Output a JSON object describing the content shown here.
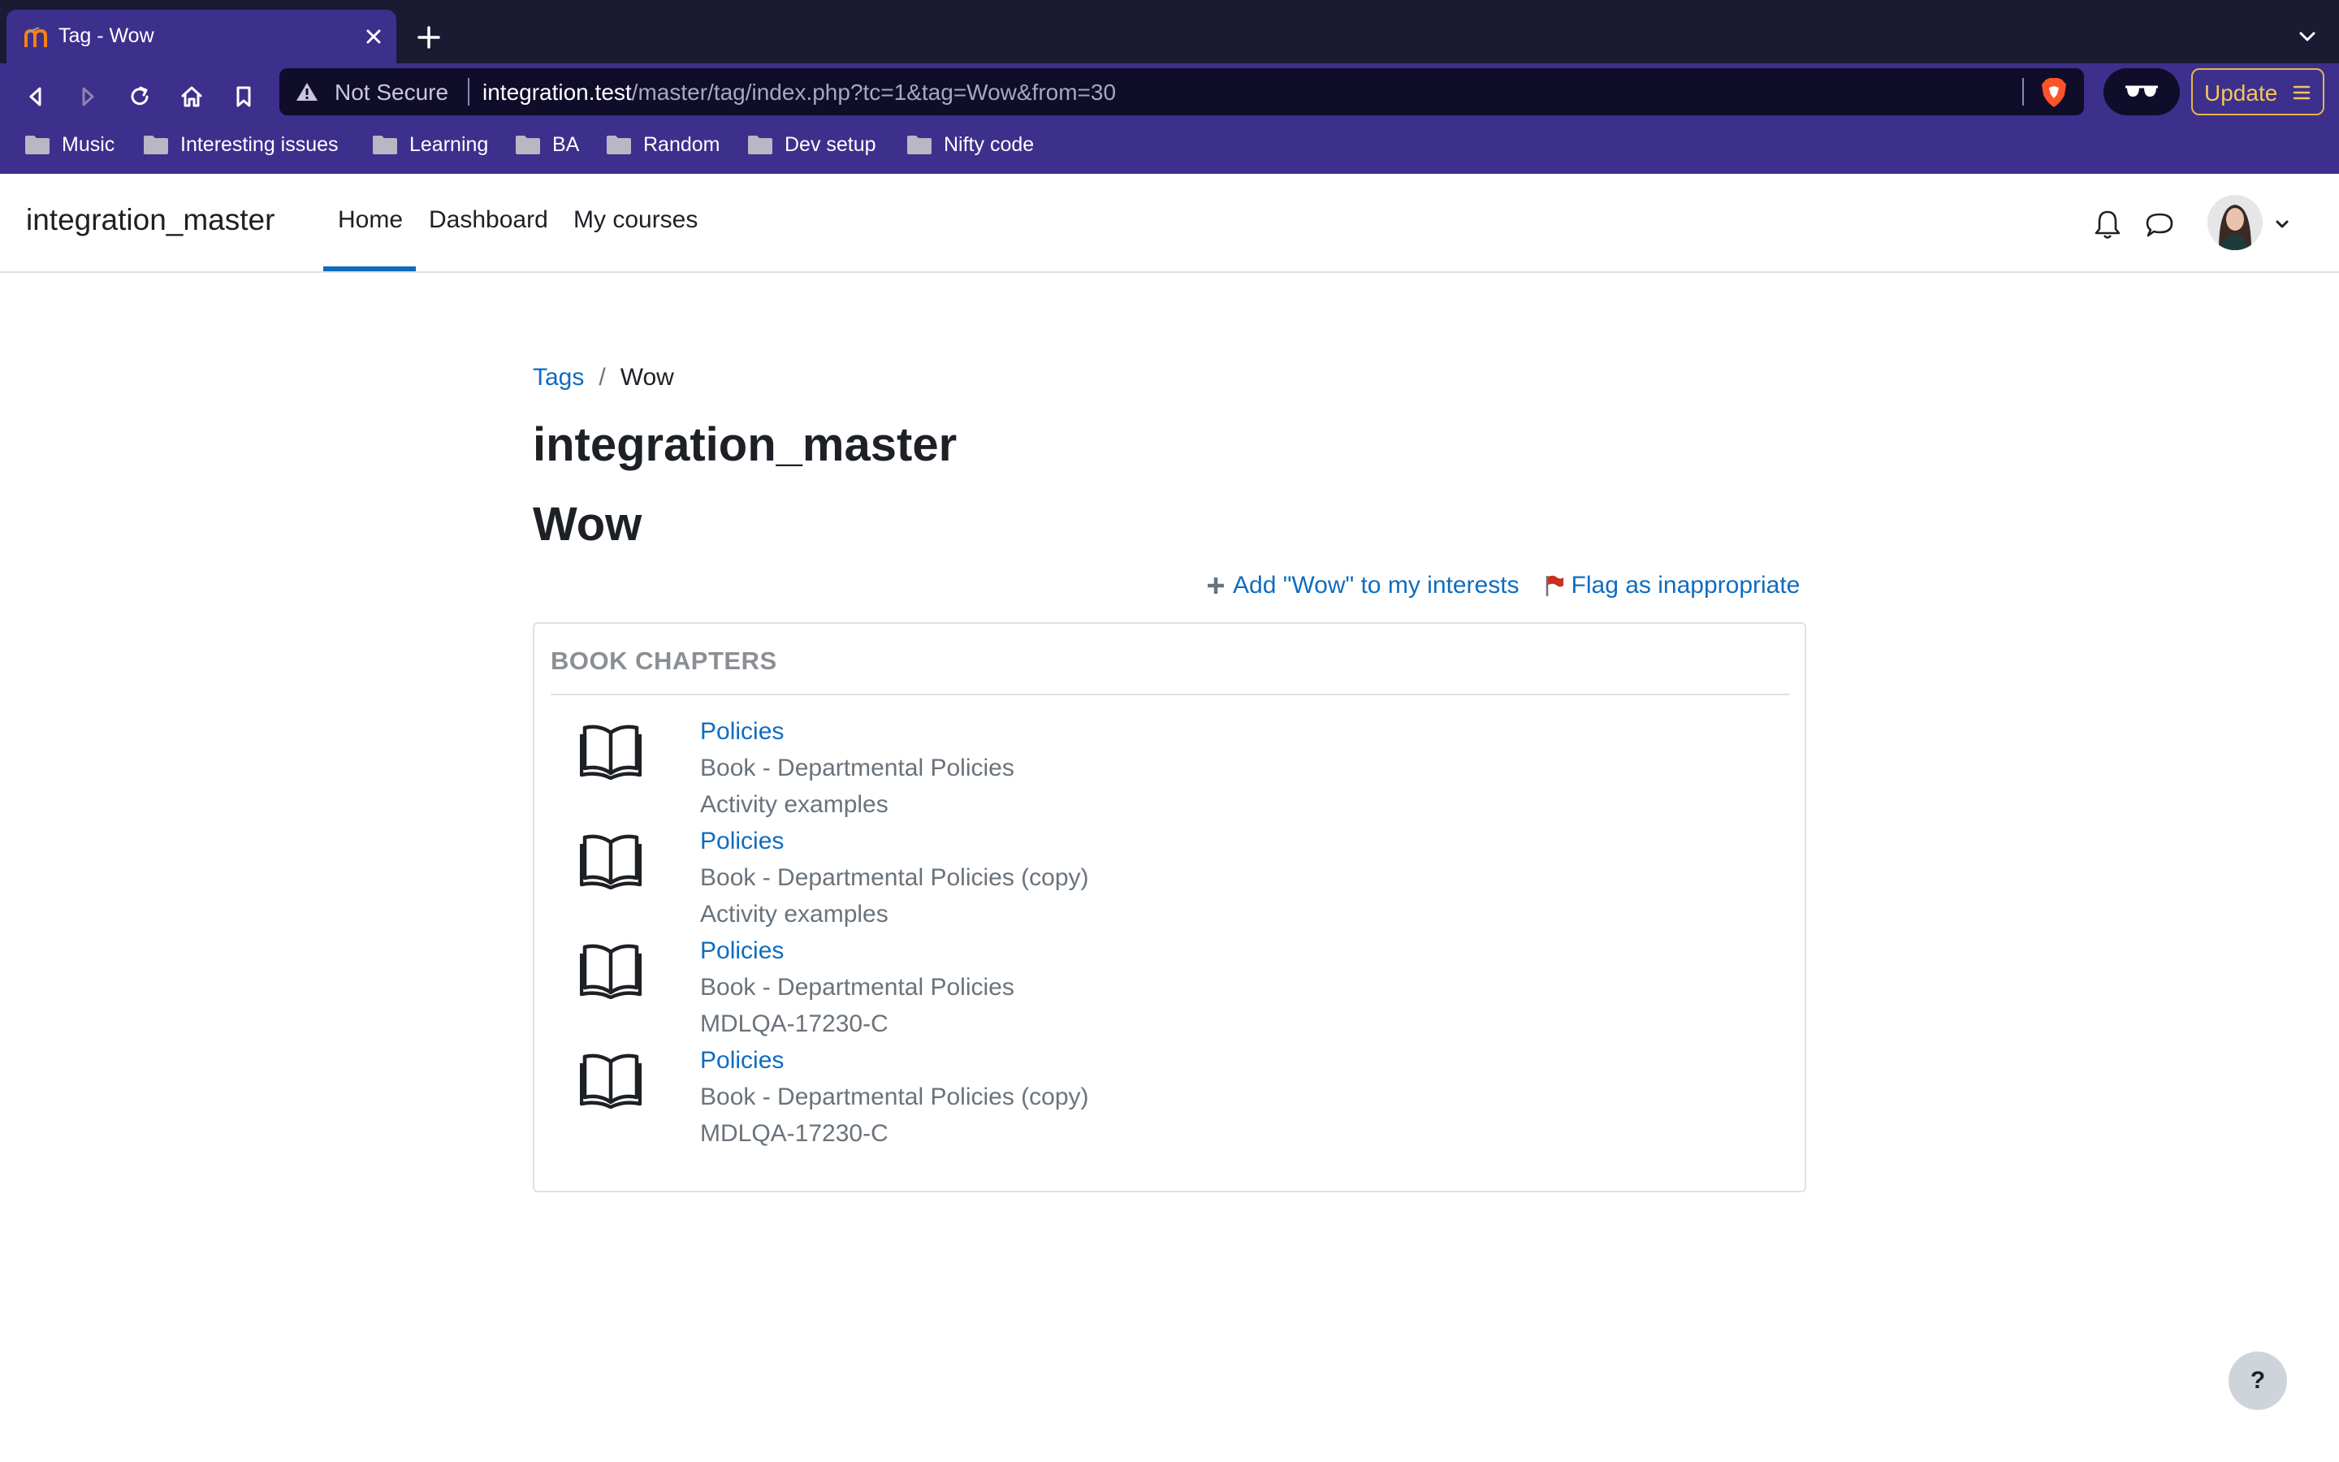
{
  "browser": {
    "tab": {
      "title": "Tag - Wow"
    },
    "url": {
      "security_label": "Not Secure",
      "host": "integration.test",
      "path": "/master/tag/index.php?tc=1&tag=Wow&from=30"
    },
    "update_label": "Update",
    "bookmarks": [
      {
        "label": "Music"
      },
      {
        "label": "Interesting issues"
      },
      {
        "label": "Learning"
      },
      {
        "label": "BA"
      },
      {
        "label": "Random"
      },
      {
        "label": "Dev setup"
      },
      {
        "label": "Nifty code"
      }
    ],
    "colors": {
      "tabstrip": "#1b1a33",
      "toolbar": "#3d2f8c",
      "accent_update": "#f3c55c"
    }
  },
  "site": {
    "brand": "integration_master",
    "nav": [
      {
        "label": "Home",
        "active": true
      },
      {
        "label": "Dashboard",
        "active": false
      },
      {
        "label": "My courses",
        "active": false
      }
    ],
    "icons": [
      "bell-icon",
      "chat-icon",
      "avatar",
      "chevron-down-icon"
    ],
    "primary_color": "#0f6cbf"
  },
  "breadcrumb": {
    "parent": "Tags",
    "separator": "/",
    "current": "Wow"
  },
  "page_title": "integration_master",
  "tag_name": "Wow",
  "actions": {
    "add_interest": "Add \"Wow\" to my interests",
    "flag": "Flag as inappropriate"
  },
  "section": {
    "title": "BOOK CHAPTERS",
    "items": [
      {
        "name": "Policies",
        "book": "Book - Departmental Policies",
        "course": "Activity examples"
      },
      {
        "name": "Policies",
        "book": "Book - Departmental Policies (copy)",
        "course": "Activity examples"
      },
      {
        "name": "Policies",
        "book": "Book - Departmental Policies",
        "course": "MDLQA-17230-C"
      },
      {
        "name": "Policies",
        "book": "Book - Departmental Policies (copy)",
        "course": "MDLQA-17230-C"
      }
    ]
  },
  "help_label": "?"
}
